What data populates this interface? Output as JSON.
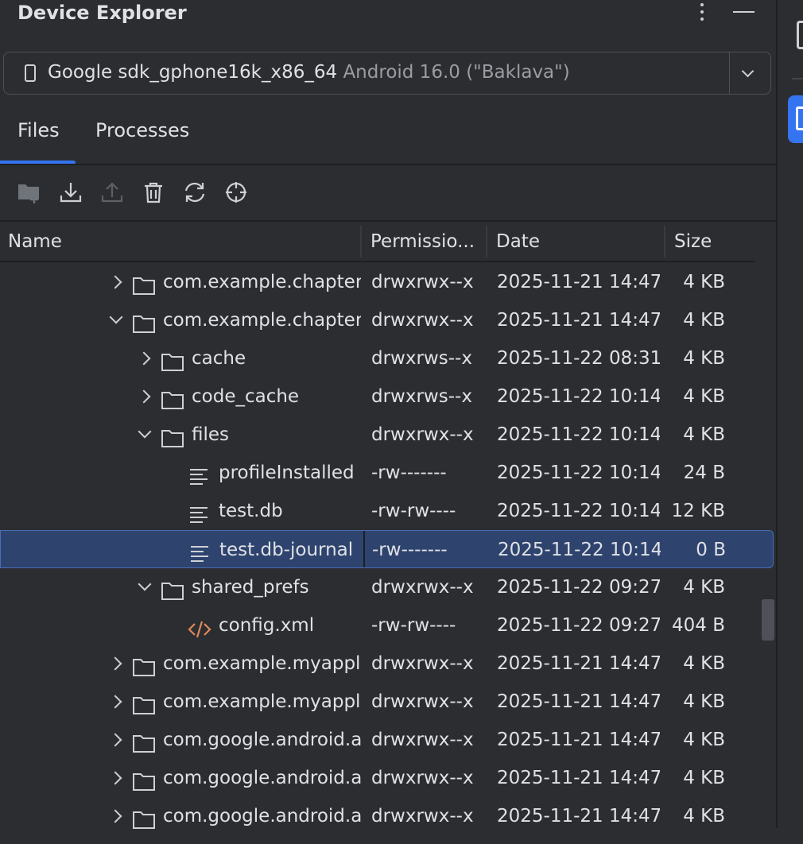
{
  "title": "Device Explorer",
  "device": {
    "name": "Google sdk_gphone16k_x86_64",
    "version": "Android 16.0 (\"Baklava\")"
  },
  "tabs": [
    {
      "label": "Files"
    },
    {
      "label": "Processes"
    }
  ],
  "toolbar": [
    {
      "icon": "new-folder-icon"
    },
    {
      "icon": "download-icon"
    },
    {
      "icon": "upload-icon"
    },
    {
      "icon": "delete-icon"
    },
    {
      "icon": "sync-icon"
    },
    {
      "icon": "locate-icon"
    }
  ],
  "columns": {
    "name": "Name",
    "permissions": "Permissio...",
    "date": "Date",
    "size": "Size"
  },
  "rows": [
    {
      "name": "com.example.chapter(",
      "permissions": "drwxrwx--x",
      "date": "2025-11-21 14:47",
      "size": "4 KB",
      "type": "folder",
      "depth": 0,
      "expander": "collapsed"
    },
    {
      "name": "com.example.chapter(",
      "permissions": "drwxrwx--x",
      "date": "2025-11-21 14:47",
      "size": "4 KB",
      "type": "folder",
      "depth": 0,
      "expander": "expanded"
    },
    {
      "name": "cache",
      "permissions": "drwxrws--x",
      "date": "2025-11-22 08:31",
      "size": "4 KB",
      "type": "folder",
      "depth": 1,
      "expander": "collapsed"
    },
    {
      "name": "code_cache",
      "permissions": "drwxrws--x",
      "date": "2025-11-22 10:14",
      "size": "4 KB",
      "type": "folder",
      "depth": 1,
      "expander": "collapsed"
    },
    {
      "name": "files",
      "permissions": "drwxrwx--x",
      "date": "2025-11-22 10:14",
      "size": "4 KB",
      "type": "folder",
      "depth": 1,
      "expander": "expanded"
    },
    {
      "name": "profileInstalled",
      "permissions": "-rw-------",
      "date": "2025-11-22 10:14",
      "size": "24 B",
      "type": "file",
      "depth": 2,
      "expander": "none"
    },
    {
      "name": "test.db",
      "permissions": "-rw-rw----",
      "date": "2025-11-22 10:14",
      "size": "12 KB",
      "type": "file",
      "depth": 2,
      "expander": "none"
    },
    {
      "name": "test.db-journal",
      "permissions": "-rw-------",
      "date": "2025-11-22 10:14",
      "size": "0 B",
      "type": "file",
      "depth": 2,
      "expander": "none",
      "selected": true
    },
    {
      "name": "shared_prefs",
      "permissions": "drwxrwx--x",
      "date": "2025-11-22 09:27",
      "size": "4 KB",
      "type": "folder",
      "depth": 1,
      "expander": "expanded"
    },
    {
      "name": "config.xml",
      "permissions": "-rw-rw----",
      "date": "2025-11-22 09:27",
      "size": "404 B",
      "type": "xml",
      "depth": 2,
      "expander": "none"
    },
    {
      "name": "com.example.myappli(",
      "permissions": "drwxrwx--x",
      "date": "2025-11-21 14:47",
      "size": "4 KB",
      "type": "folder",
      "depth": 0,
      "expander": "collapsed"
    },
    {
      "name": "com.example.myappli(",
      "permissions": "drwxrwx--x",
      "date": "2025-11-21 14:47",
      "size": "4 KB",
      "type": "folder",
      "depth": 0,
      "expander": "collapsed"
    },
    {
      "name": "com.google.android.a",
      "permissions": "drwxrwx--x",
      "date": "2025-11-21 14:47",
      "size": "4 KB",
      "type": "folder",
      "depth": 0,
      "expander": "collapsed"
    },
    {
      "name": "com.google.android.a",
      "permissions": "drwxrwx--x",
      "date": "2025-11-21 14:47",
      "size": "4 KB",
      "type": "folder",
      "depth": 0,
      "expander": "collapsed"
    },
    {
      "name": "com.google.android.a",
      "permissions": "drwxrwx--x",
      "date": "2025-11-21 14:47",
      "size": "4 KB",
      "type": "folder",
      "depth": 0,
      "expander": "collapsed"
    }
  ],
  "colors": {
    "accent": "#3574f0",
    "selection": "#2e436e",
    "xml": "#e0875b"
  }
}
